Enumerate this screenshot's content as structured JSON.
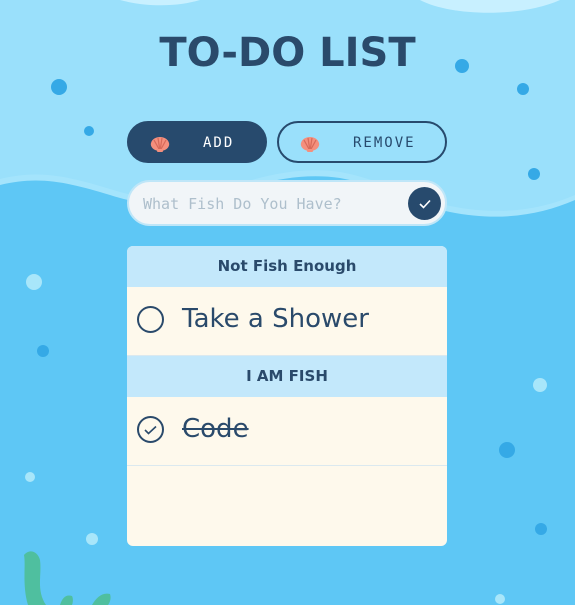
{
  "app": {
    "title": "TO-DO LIST"
  },
  "toolbar": {
    "add_label": "ADD",
    "remove_label": "REMOVE"
  },
  "input": {
    "placeholder": "What Fish Do You Have?",
    "value": ""
  },
  "sections": [
    {
      "title": "Not Fish Enough",
      "items": [
        {
          "text": "Take a Shower",
          "done": false
        }
      ]
    },
    {
      "title": "I AM FISH",
      "items": [
        {
          "text": "Code",
          "done": true
        }
      ]
    }
  ],
  "colors": {
    "primary": "#274a6d",
    "background": "#5ec7f5",
    "light_wave": "#9fe2fb",
    "card": "#fef9ec",
    "section_header": "#c3e8fb",
    "shell": "#f48f7d"
  },
  "icons": {
    "button_icon": "seashell-icon",
    "submit_icon": "checkmark-icon"
  }
}
